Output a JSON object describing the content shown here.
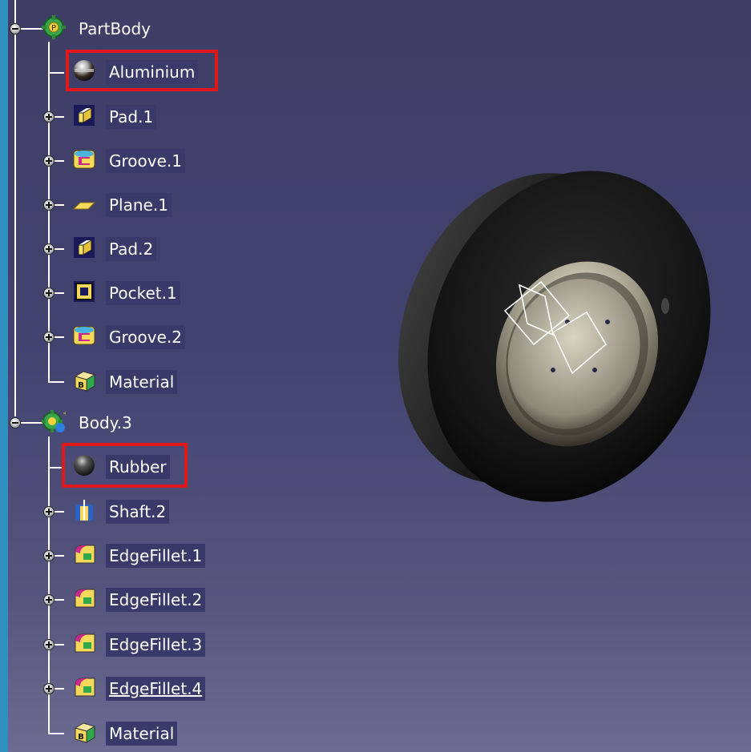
{
  "tree": {
    "nodes": [
      {
        "label": "PartBody",
        "icon": "part-body-gear-icon"
      },
      {
        "label": "Aluminium",
        "icon": "material-sphere-aluminium-icon"
      },
      {
        "label": "Pad.1",
        "icon": "pad-icon"
      },
      {
        "label": "Groove.1",
        "icon": "groove-icon"
      },
      {
        "label": "Plane.1",
        "icon": "plane-icon"
      },
      {
        "label": "Pad.2",
        "icon": "pad-icon"
      },
      {
        "label": "Pocket.1",
        "icon": "pocket-icon"
      },
      {
        "label": "Groove.2",
        "icon": "groove-icon"
      },
      {
        "label": "Material",
        "icon": "material-box-icon"
      },
      {
        "label": "Body.3",
        "icon": "body-gear-icon"
      },
      {
        "label": "Rubber",
        "icon": "material-sphere-rubber-icon"
      },
      {
        "label": "Shaft.2",
        "icon": "shaft-icon"
      },
      {
        "label": "EdgeFillet.1",
        "icon": "edge-fillet-icon"
      },
      {
        "label": "EdgeFillet.2",
        "icon": "edge-fillet-icon"
      },
      {
        "label": "EdgeFillet.3",
        "icon": "edge-fillet-icon"
      },
      {
        "label": "EdgeFillet.4",
        "icon": "edge-fillet-icon"
      },
      {
        "label": "Material",
        "icon": "material-box-icon"
      }
    ]
  },
  "colors": {
    "highlight": "#e01818",
    "background_top": "#3e3e66",
    "background_bottom": "#6c6c92",
    "label_bg": "#3a3a6a"
  },
  "viewport": {
    "model": "wheel-with-rubber-tire-and-aluminium-rim"
  }
}
